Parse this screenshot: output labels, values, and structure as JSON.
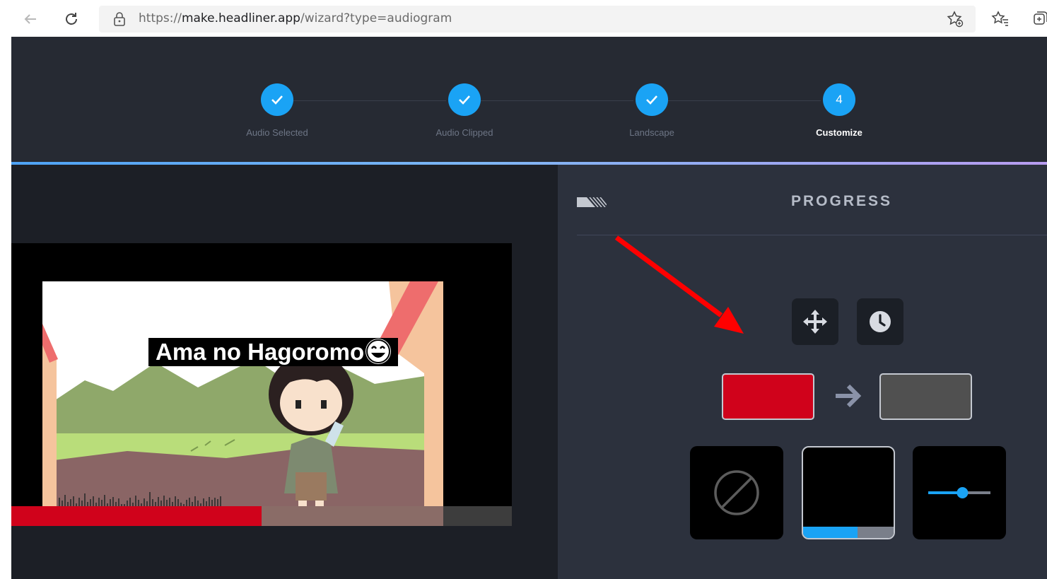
{
  "browser": {
    "url_prefix": "https://",
    "url_host": "make.headliner.app",
    "url_path": "/wizard?type=audiogram",
    "icons": [
      "back-arrow-icon",
      "refresh-icon",
      "lock-icon",
      "add-favorite-icon",
      "favorites-icon",
      "collections-icon"
    ]
  },
  "stepper": {
    "steps": [
      {
        "label": "Audio Selected",
        "status": "done"
      },
      {
        "label": "Audio Clipped",
        "status": "done"
      },
      {
        "label": "Landscape",
        "status": "done"
      },
      {
        "label": "Customize",
        "status": "active",
        "number": "4"
      }
    ]
  },
  "preview": {
    "video_title": "Ama no Hagoromo",
    "progress_fraction": 0.5,
    "colors": {
      "progress_fill": "#d0021b",
      "progress_track": "#3d3d3d"
    }
  },
  "panel": {
    "title": "PROGRESS",
    "tool_icons": [
      "move-icon",
      "clock-icon"
    ],
    "color_from": "#d0021b",
    "color_to": "#505050",
    "options": [
      {
        "name": "none",
        "icon": "no-symbol-icon"
      },
      {
        "name": "bar",
        "selected": true,
        "fill_fraction": 0.6
      },
      {
        "name": "slider",
        "icon": "slider-icon",
        "level_fraction": 0.55
      }
    ]
  },
  "annotation": {
    "color": "#ff0000"
  }
}
